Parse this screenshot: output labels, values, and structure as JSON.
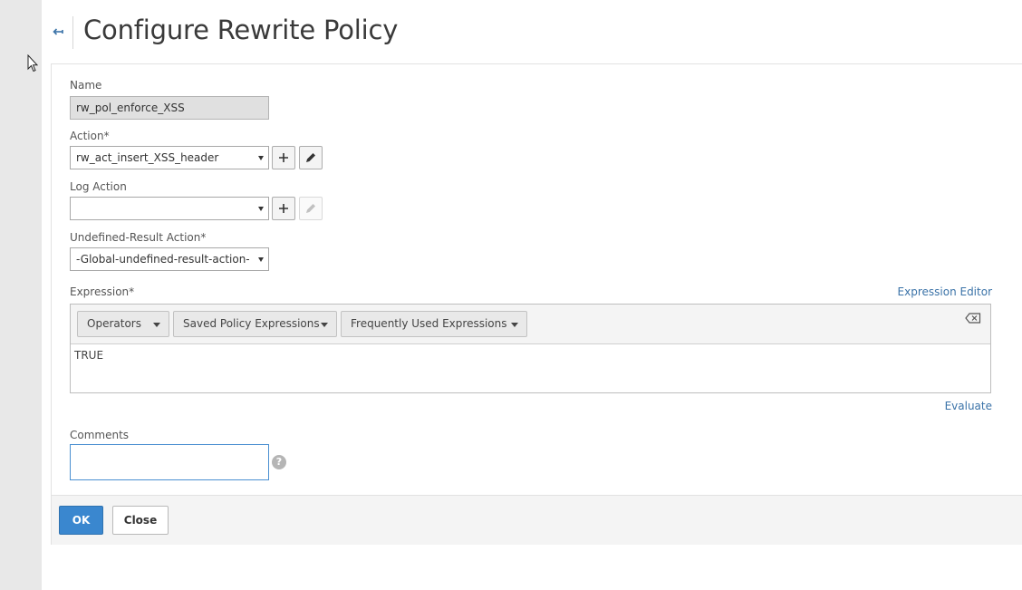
{
  "page": {
    "title": "Configure Rewrite Policy"
  },
  "form": {
    "name": {
      "label": "Name",
      "value": "rw_pol_enforce_XSS"
    },
    "action": {
      "label": "Action*",
      "value": "rw_act_insert_XSS_header"
    },
    "log_action": {
      "label": "Log Action",
      "value": ""
    },
    "undefined_result_action": {
      "label": "Undefined-Result Action*",
      "value": "-Global-undefined-result-action-"
    },
    "expression": {
      "label": "Expression*",
      "editor_link": "Expression Editor",
      "toolbar": {
        "operators": "Operators",
        "saved_policy": "Saved Policy Expressions",
        "frequently_used": "Frequently Used Expressions"
      },
      "value": "TRUE",
      "evaluate_link": "Evaluate"
    },
    "comments": {
      "label": "Comments",
      "value": "",
      "help_glyph": "?"
    }
  },
  "footer": {
    "ok_label": "OK",
    "close_label": "Close"
  },
  "icons": {
    "back": "back-arrow-icon",
    "add": "plus-icon",
    "edit": "pencil-icon",
    "clear": "clear-icon",
    "help": "help-icon"
  },
  "colors": {
    "primary": "#3a87cf",
    "link": "#3b73a8",
    "focus_border": "#4a8fd1"
  }
}
